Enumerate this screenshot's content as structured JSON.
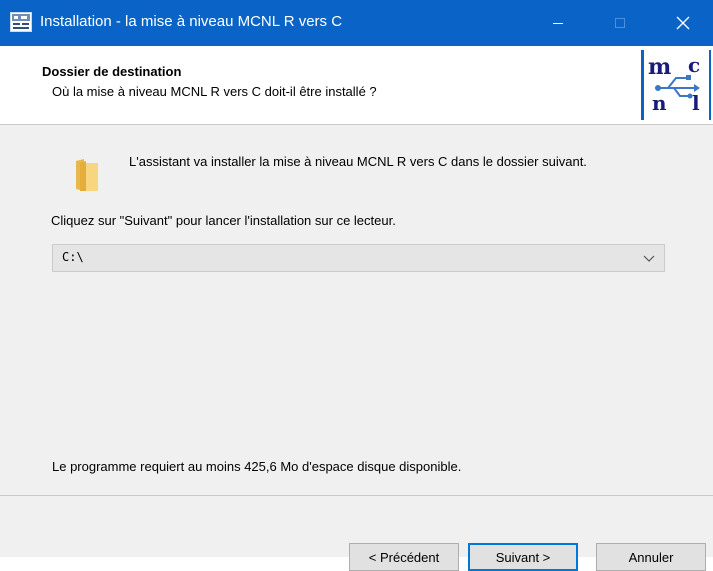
{
  "window": {
    "title": "Installation - la mise à niveau MCNL R vers C",
    "accent_color": "#0a64c7"
  },
  "header": {
    "title": "Dossier de destination",
    "subtitle": "Où la mise à niveau MCNL R vers C doit-il être installé ?",
    "logo_letters": [
      "m",
      "c",
      "n",
      "l"
    ]
  },
  "body": {
    "intro": "L'assistant va installer la mise à niveau MCNL R vers C dans le dossier suivant.",
    "prompt": "Cliquez sur \"Suivant\" pour lancer l'installation sur ce lecteur.",
    "drive_value": "C:\\",
    "disk_requirement": "Le programme requiert au moins 425,6 Mo d'espace disque disponible."
  },
  "buttons": {
    "previous": "< Précédent",
    "next": "Suivant >",
    "cancel": "Annuler"
  }
}
